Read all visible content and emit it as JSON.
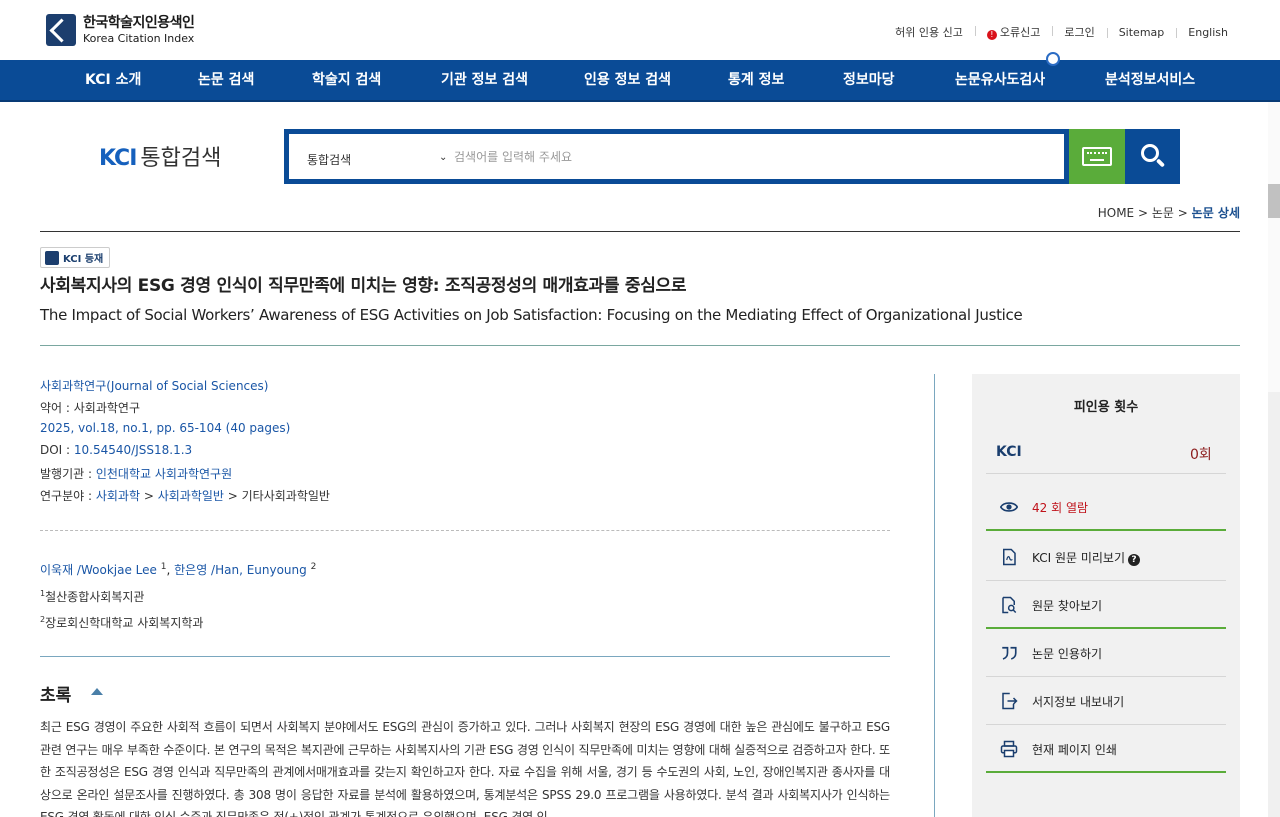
{
  "header": {
    "logo_ko": "한국학술지인용색인",
    "logo_en": "Korea Citation Index",
    "utils": [
      "허위 인용 신고",
      "오류신고",
      "로그인",
      "Sitemap",
      "English"
    ]
  },
  "nav": [
    "KCI 소개",
    "논문 검색",
    "학술지 검색",
    "기관 정보 검색",
    "인용 정보 검색",
    "통계 정보",
    "정보마당",
    "논문유사도검사",
    "분석정보서비스"
  ],
  "search": {
    "brand_kci": "KCI",
    "brand_text": "통합검색",
    "scope": "통합검색",
    "placeholder": "검색어를 입력해 주세요"
  },
  "breadcrumb": {
    "home": "HOME",
    "sep": ">",
    "level1": "논문",
    "current": "논문 상세"
  },
  "paper": {
    "badge": "KCI 등재",
    "title_ko": "사회복지사의 ESG 경영 인식이 직무만족에 미치는 영향: 조직공정성의 매개효과를 중심으로",
    "title_en": "The Impact of Social Workers’ Awareness of ESG Activities on Job Satisfaction: Focusing on the Mediating Effect of Organizational Justice",
    "journal": "사회과학연구(Journal of Social Sciences)",
    "abbr_label": "약어 : ",
    "abbr": "사회과학연구",
    "volume": "2025, vol.18, no.1, pp. 65-104 (40 pages)",
    "doi_label": "DOI : ",
    "doi": "10.54540/JSS18.1.3",
    "publisher_label": "발행기관 : ",
    "publisher": "인천대학교 사회과학연구원",
    "field_label": "연구분야 : ",
    "field1": "사회과학",
    "field2": "사회과학일반",
    "field3": "기타사회과학일반",
    "authors": [
      {
        "name": "이욱재 /Wookjae Lee",
        "sup": "1"
      },
      {
        "name": "한은영 /Han, Eunyoung",
        "sup": "2"
      }
    ],
    "affiliations": [
      {
        "sup": "1",
        "text": "철산종합사회복지관"
      },
      {
        "sup": "2",
        "text": "장로회신학대학교 사회복지학과"
      }
    ],
    "abstract_title": "초록",
    "abstract": "최근 ESG 경영이 주요한 사회적 흐름이 되면서 사회복지 분야에서도 ESG의 관심이 증가하고 있다. 그러나 사회복지 현장의 ESG 경영에 대한 높은 관심에도 불구하고 ESG 관련 연구는 매우 부족한 수준이다. 본 연구의 목적은 복지관에 근무하는 사회복지사의 기관 ESG 경영 인식이 직무만족에 미치는 영향에 대해 실증적으로 검증하고자 한다. 또한 조직공정성은 ESG 경영 인식과 직무만족의 관계에서매개효과를 갖는지 확인하고자 한다. 자료 수집을 위해 서울, 경기 등 수도권의 사회, 노인, 장애인복지관 종사자를 대상으로 온라인 설문조사를 진행하였다. 총 308 명이 응답한 자료를 분석에 활용하였으며, 통계분석은 SPSS 29.0 프로그램을 사용하였다. 분석 결과 사회복지사가 인식하는 ESG 경영 활동에 대한 인식 수준과 직무만족은 정(+)적인 관계가 통계적으로 유의했으며, ESG 경영 인"
  },
  "side": {
    "heading": "피인용 횟수",
    "kci_label": "KCI",
    "kci_count": "0회",
    "views": "42 회 열람",
    "items": [
      "KCI 원문 미리보기",
      "원문 찾아보기",
      "논문 인용하기",
      "서지정보 내보내기",
      "현재 페이지 인쇄"
    ]
  }
}
